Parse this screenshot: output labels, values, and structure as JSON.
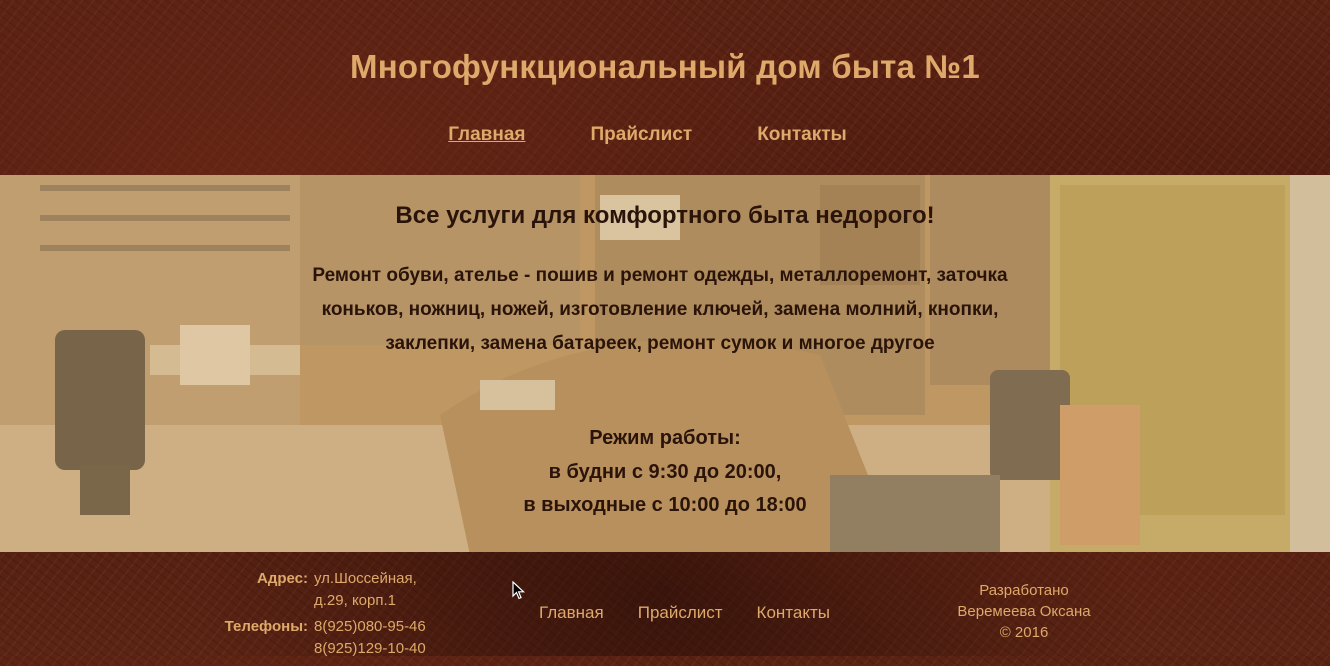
{
  "header": {
    "title": "Многофункциональный дом быта №1",
    "nav": [
      {
        "label": "Главная",
        "active": true
      },
      {
        "label": "Прайслист",
        "active": false
      },
      {
        "label": "Контакты",
        "active": false
      }
    ]
  },
  "hero": {
    "heading": "Все услуги для комфортного быта недорого!",
    "services": "Ремонт обуви, ателье - пошив и ремонт одежды, металлоремонт, заточка коньков, ножниц, ножей, изготовление ключей, замена молний, кнопки, заклепки, замена батареек, ремонт сумок и многое другое",
    "hours_title": "Режим работы:",
    "hours_weekdays": "в будни с 9:30 до 20:00,",
    "hours_weekends": "в выходные с 10:00 до 18:00"
  },
  "footer": {
    "address_label": "Адрес:",
    "address_value": "ул.Шоссейная, д.29, корп.1",
    "phones_label": "Телефоны:",
    "phone_1": "8(925)080-95-46",
    "phone_2": "8(925)129-10-40",
    "nav": [
      "Главная",
      "Прайслист",
      "Контакты"
    ],
    "credits_line1": "Разработано",
    "credits_line2": "Веремеева Оксана",
    "credits_line3": "© 2016"
  },
  "colors": {
    "gold_text": "#dea96a",
    "dark_text": "#2a140a",
    "leather": "#4a1a0e"
  }
}
